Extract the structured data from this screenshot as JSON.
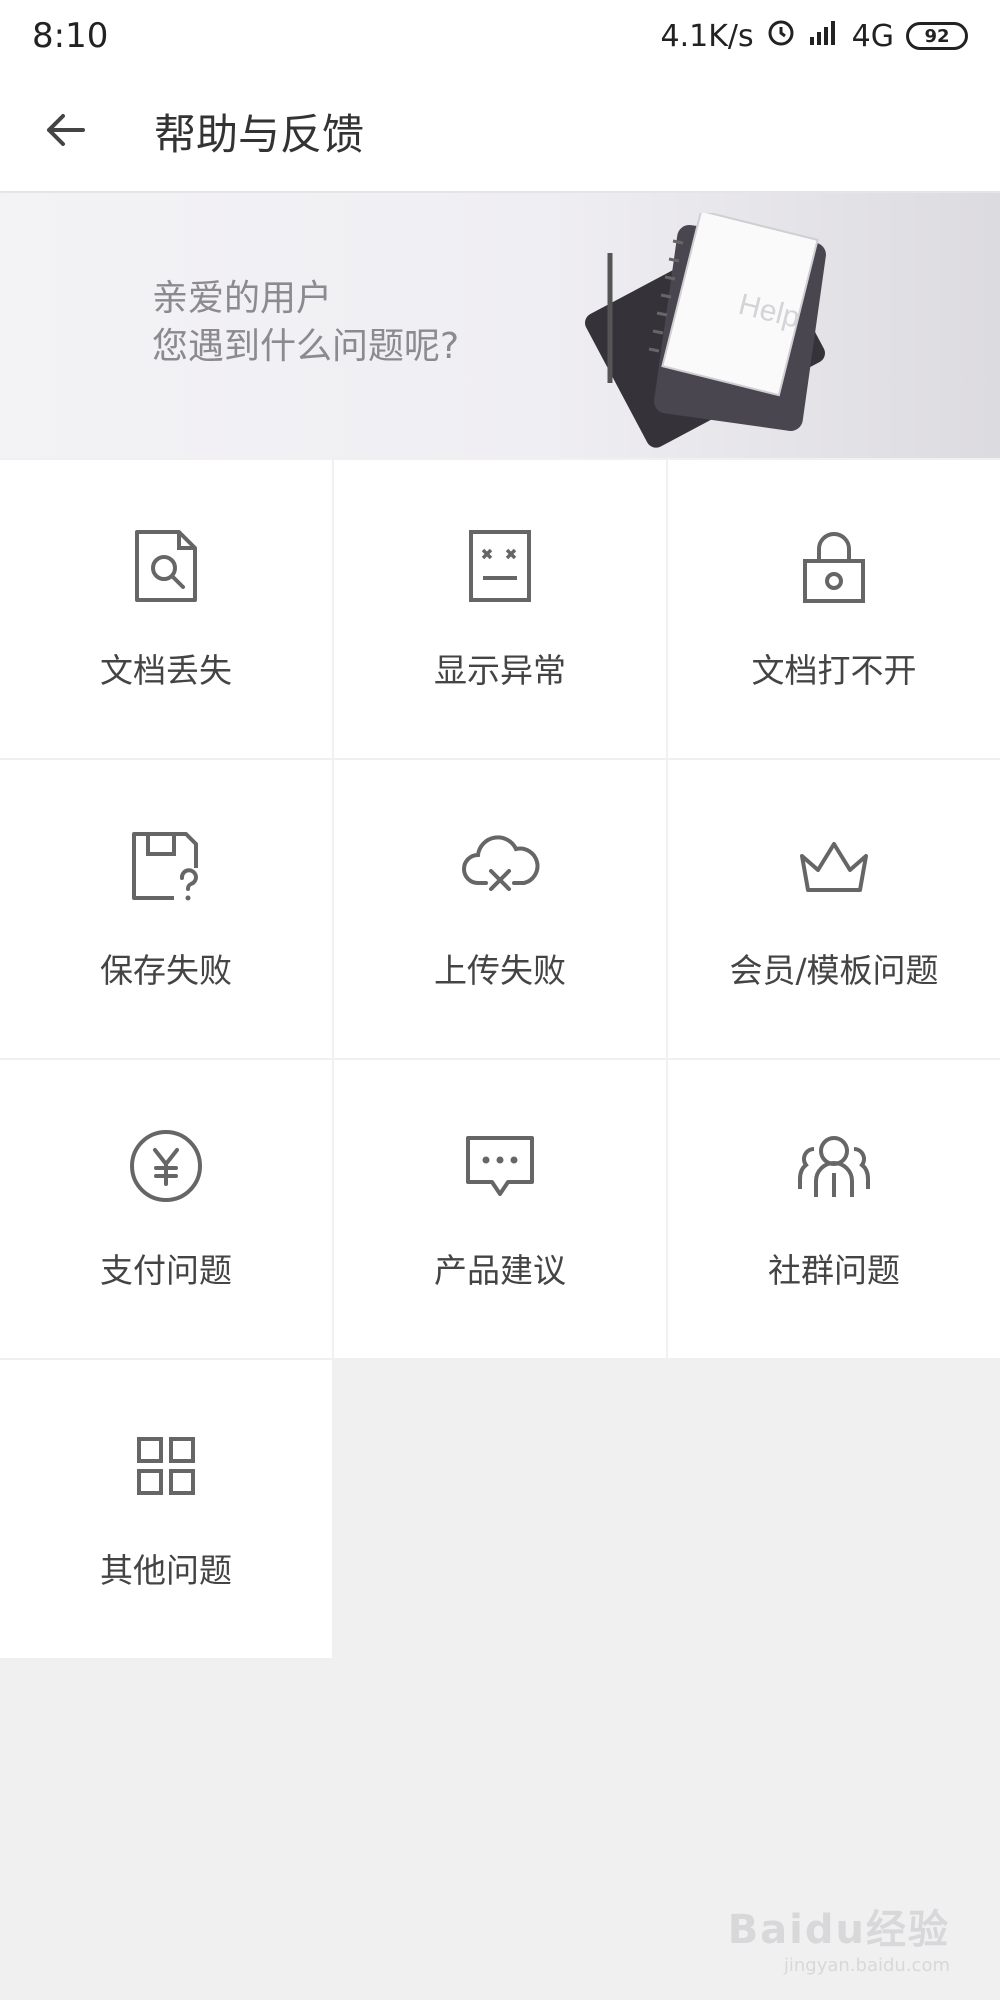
{
  "status_bar": {
    "time": "8:10",
    "speed": "4.1K/s",
    "network": "4G",
    "battery": "92"
  },
  "app_bar": {
    "title": "帮助与反馈"
  },
  "banner": {
    "line1": "亲爱的用户",
    "line2": "您遇到什么问题呢?",
    "art_text": "Help"
  },
  "grid": {
    "items": [
      {
        "label": "文档丢失",
        "icon": "document-search-icon"
      },
      {
        "label": "显示异常",
        "icon": "document-error-icon"
      },
      {
        "label": "文档打不开",
        "icon": "lock-icon"
      },
      {
        "label": "保存失败",
        "icon": "save-question-icon"
      },
      {
        "label": "上传失败",
        "icon": "cloud-error-icon"
      },
      {
        "label": "会员/模板问题",
        "icon": "crown-icon"
      },
      {
        "label": "支付问题",
        "icon": "yen-icon"
      },
      {
        "label": "产品建议",
        "icon": "chat-bubble-icon"
      },
      {
        "label": "社群问题",
        "icon": "community-icon"
      },
      {
        "label": "其他问题",
        "icon": "grid-icon"
      }
    ]
  },
  "watermark": {
    "main": "Baidu经验",
    "sub": "jingyan.baidu.com"
  },
  "colors": {
    "icon_stroke": "#666666",
    "page_background": "#f0f0f1"
  }
}
